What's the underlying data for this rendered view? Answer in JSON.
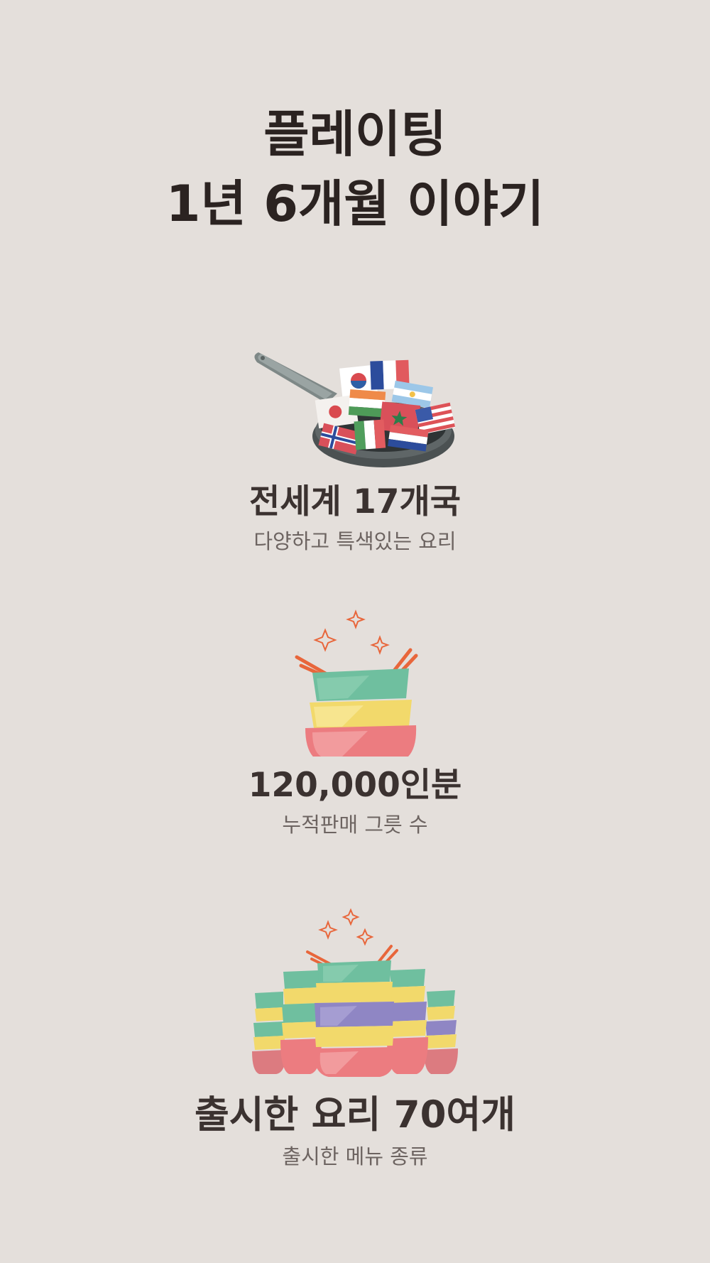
{
  "page": {
    "background": "#e4dfdb",
    "title_lines": [
      "플레이팅",
      "1년 6개월 이야기"
    ]
  },
  "stats": [
    {
      "headline": "전세계 17개국",
      "caption": "다양하고 특색있는 요리",
      "illustration": "frying-pan-with-world-flags"
    },
    {
      "headline": "120,000인분",
      "caption": "누적판매 그릇 수",
      "illustration": "stacked-bowls-with-chopsticks"
    },
    {
      "headline": "출시한 요리 70여개",
      "caption": "출시한 메뉴 종류",
      "illustration": "many-stacked-bowls"
    }
  ],
  "colors": {
    "mint": "#6fbf9f",
    "yellow": "#f2d96b",
    "pink": "#ec7c80",
    "purple": "#8f86c4",
    "accent_orange": "#e8663b"
  }
}
